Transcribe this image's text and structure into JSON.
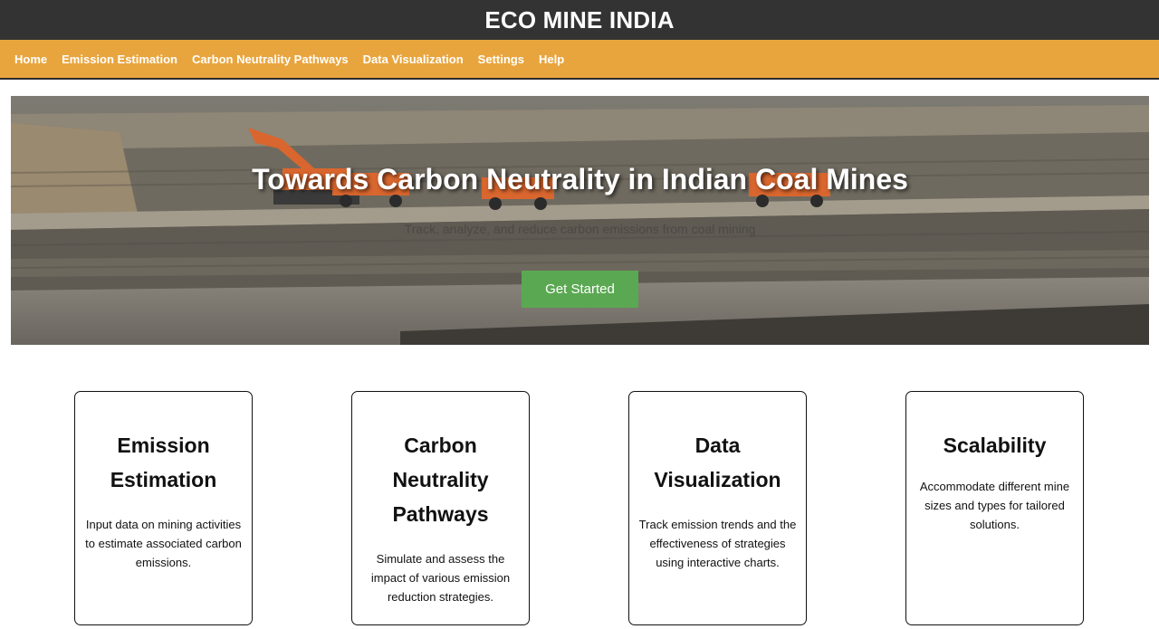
{
  "header": {
    "title": "ECO MINE INDIA"
  },
  "nav": {
    "items": [
      {
        "label": "Home"
      },
      {
        "label": "Emission Estimation"
      },
      {
        "label": "Carbon Neutrality Pathways"
      },
      {
        "label": "Data Visualization"
      },
      {
        "label": "Settings"
      },
      {
        "label": "Help"
      }
    ]
  },
  "hero": {
    "title": "Towards Carbon Neutrality in Indian Coal Mines",
    "subtitle": "Track, analyze, and reduce carbon emissions from coal mining",
    "button_label": "Get Started"
  },
  "features": [
    {
      "title": "Emission Estimation",
      "description": "Input data on mining activities to estimate associated carbon emissions."
    },
    {
      "title": "Carbon Neutrality Pathways",
      "description": "Simulate and assess the impact of various emission reduction strategies."
    },
    {
      "title": "Data Visualization",
      "description": "Track emission trends and the effectiveness of strategies using interactive charts."
    },
    {
      "title": "Scalability",
      "description": "Accommodate different mine sizes and types for tailored solutions."
    }
  ],
  "colors": {
    "header_bg": "#333333",
    "nav_bg": "#e9a53d",
    "button_bg": "#5aa852"
  }
}
